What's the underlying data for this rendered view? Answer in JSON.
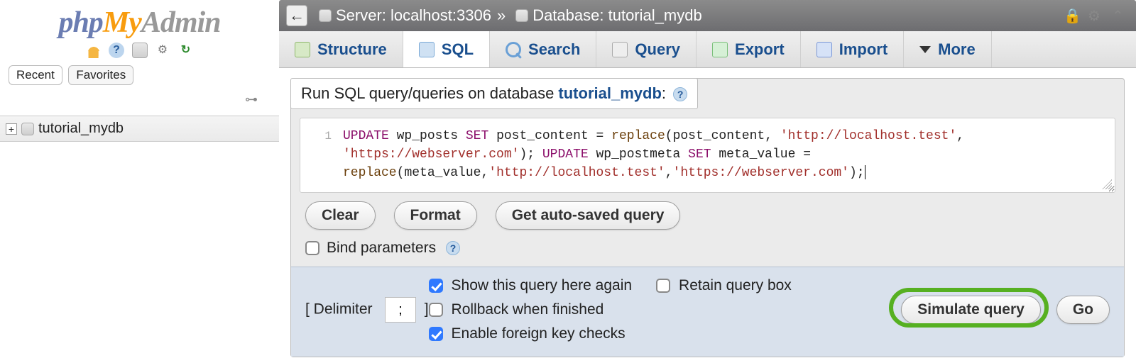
{
  "logo": {
    "p1": "php",
    "p2": "My",
    "p3": "Admin"
  },
  "sidebar": {
    "icons": [
      "home-icon",
      "help-icon",
      "sql-icon",
      "gear-icon",
      "reload-icon"
    ],
    "tabs": [
      "Recent",
      "Favorites"
    ],
    "link_icon": "link-icon",
    "tree": {
      "db": "tutorial_mydb"
    }
  },
  "breadcrumb": {
    "server_label": "Server:",
    "server_value": "localhost:3306",
    "db_label": "Database:",
    "db_value": "tutorial_mydb",
    "sep": "»"
  },
  "nav": {
    "structure": "Structure",
    "sql": "SQL",
    "search": "Search",
    "query": "Query",
    "export": "Export",
    "import": "Import",
    "more": "More"
  },
  "panel": {
    "title_prefix": "Run SQL query/queries on database ",
    "title_db": "tutorial_mydb",
    "title_suffix": ":"
  },
  "editor": {
    "line_number": "1",
    "sql_raw": "UPDATE wp_posts SET post_content = replace(post_content, 'http://localhost.test', 'https://webserver.com'); UPDATE wp_postmeta SET meta_value = replace(meta_value,'http://localhost.test','https://webserver.com');",
    "tokens": [
      {
        "t": "kw",
        "v": "UPDATE"
      },
      {
        "t": "sp"
      },
      {
        "t": "id",
        "v": "wp_posts"
      },
      {
        "t": "sp"
      },
      {
        "t": "kw",
        "v": "SET"
      },
      {
        "t": "sp"
      },
      {
        "t": "id",
        "v": "post_content"
      },
      {
        "t": "sp"
      },
      {
        "t": "id",
        "v": "="
      },
      {
        "t": "sp"
      },
      {
        "t": "fn",
        "v": "replace"
      },
      {
        "t": "id",
        "v": "("
      },
      {
        "t": "id",
        "v": "post_content"
      },
      {
        "t": "id",
        "v": ","
      },
      {
        "t": "sp"
      },
      {
        "t": "str",
        "v": "'http://localhost.test'"
      },
      {
        "t": "id",
        "v": ","
      },
      {
        "t": "br"
      },
      {
        "t": "str",
        "v": "'https://webserver.com'"
      },
      {
        "t": "id",
        "v": ");"
      },
      {
        "t": "sp"
      },
      {
        "t": "kw",
        "v": "UPDATE"
      },
      {
        "t": "sp"
      },
      {
        "t": "id",
        "v": "wp_postmeta"
      },
      {
        "t": "sp"
      },
      {
        "t": "kw",
        "v": "SET"
      },
      {
        "t": "sp"
      },
      {
        "t": "id",
        "v": "meta_value"
      },
      {
        "t": "sp"
      },
      {
        "t": "id",
        "v": "="
      },
      {
        "t": "br"
      },
      {
        "t": "fn",
        "v": "replace"
      },
      {
        "t": "id",
        "v": "("
      },
      {
        "t": "id",
        "v": "meta_value"
      },
      {
        "t": "id",
        "v": ","
      },
      {
        "t": "str",
        "v": "'http://localhost.test'"
      },
      {
        "t": "id",
        "v": ","
      },
      {
        "t": "str",
        "v": "'https://webserver.com'"
      },
      {
        "t": "id",
        "v": ");"
      }
    ]
  },
  "buttons": {
    "clear": "Clear",
    "format": "Format",
    "autosaved": "Get auto-saved query"
  },
  "bind": {
    "label": "Bind parameters"
  },
  "footer": {
    "delimiter_label": "Delimiter",
    "delimiter_value": ";",
    "show_again": "Show this query here again",
    "retain": "Retain query box",
    "rollback": "Rollback when finished",
    "fk": "Enable foreign key checks",
    "simulate": "Simulate query",
    "go": "Go",
    "checks": {
      "show_again": true,
      "retain": false,
      "rollback": false,
      "fk": true
    }
  }
}
